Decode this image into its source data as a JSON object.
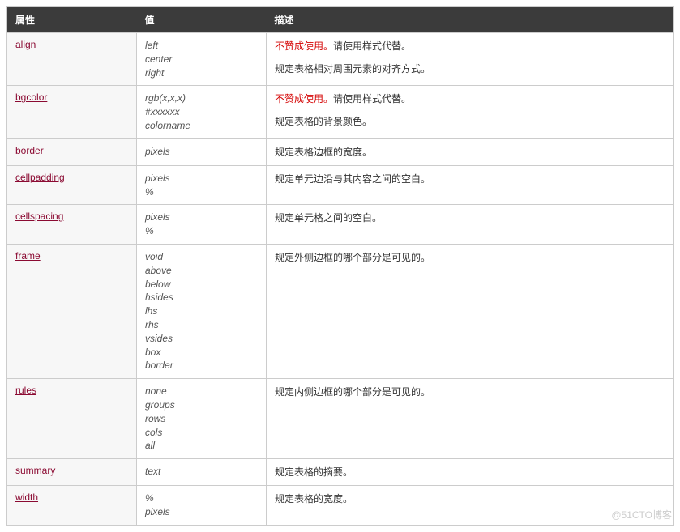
{
  "headers": {
    "attr": "属性",
    "value": "值",
    "desc": "描述"
  },
  "deprecated_label": "不赞成使用。",
  "deprecated_tail": "请使用样式代替。",
  "rows": [
    {
      "attr": "align",
      "values": [
        "left",
        "center",
        "right"
      ],
      "deprecated": true,
      "desc": "规定表格相对周围元素的对齐方式。"
    },
    {
      "attr": "bgcolor",
      "values": [
        "rgb(x,x,x)",
        "#xxxxxx",
        "colorname"
      ],
      "deprecated": true,
      "desc": "规定表格的背景颜色。"
    },
    {
      "attr": "border",
      "values": [
        "pixels"
      ],
      "deprecated": false,
      "desc": "规定表格边框的宽度。"
    },
    {
      "attr": "cellpadding",
      "values": [
        "pixels",
        "%"
      ],
      "deprecated": false,
      "desc": "规定单元边沿与其内容之间的空白。"
    },
    {
      "attr": "cellspacing",
      "values": [
        "pixels",
        "%"
      ],
      "deprecated": false,
      "desc": "规定单元格之间的空白。"
    },
    {
      "attr": "frame",
      "values": [
        "void",
        "above",
        "below",
        "hsides",
        "lhs",
        "rhs",
        "vsides",
        "box",
        "border"
      ],
      "deprecated": false,
      "desc": "规定外侧边框的哪个部分是可见的。"
    },
    {
      "attr": "rules",
      "values": [
        "none",
        "groups",
        "rows",
        "cols",
        "all"
      ],
      "deprecated": false,
      "desc": "规定内侧边框的哪个部分是可见的。"
    },
    {
      "attr": "summary",
      "values": [
        "text"
      ],
      "deprecated": false,
      "desc": "规定表格的摘要。"
    },
    {
      "attr": "width",
      "values": [
        "%",
        "pixels"
      ],
      "deprecated": false,
      "desc": "规定表格的宽度。"
    }
  ],
  "watermark": "@51CTO博客"
}
